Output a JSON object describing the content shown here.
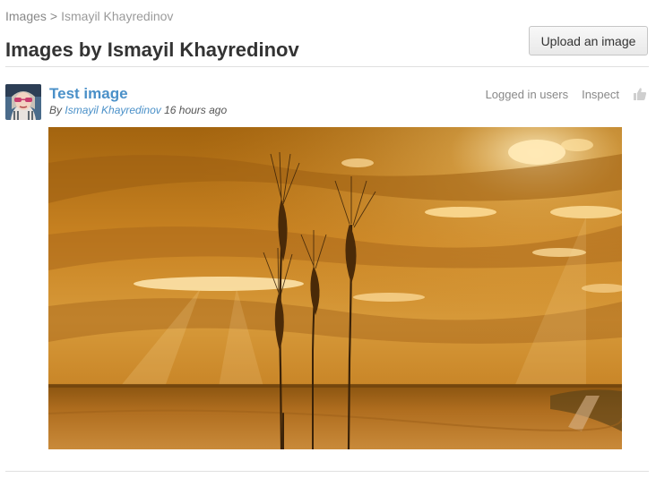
{
  "breadcrumb": {
    "root": "Images",
    "separator": ">",
    "current": "Ismayil Khayredinov"
  },
  "header": {
    "title": "Images by Ismayil Khayredinov",
    "upload_button": "Upload an image"
  },
  "post": {
    "title": "Test image",
    "by_prefix": "By",
    "author": "Ismayil Khayredinov",
    "time": "16 hours ago",
    "access": "Logged in users",
    "inspect": "Inspect",
    "like_icon": "thumbs-up-icon",
    "avatar_icon": "user-avatar",
    "image_description_icon": "wheat-sunset-image"
  },
  "colors": {
    "link": "#4a90c8",
    "muted": "#888888",
    "divider": "#e0e0e0",
    "image_sky": "#c07a1c"
  }
}
